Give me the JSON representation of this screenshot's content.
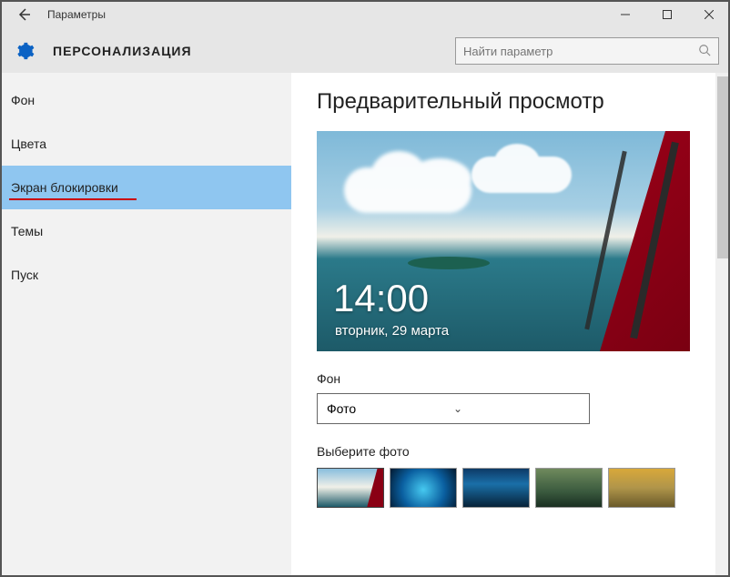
{
  "window": {
    "title": "Параметры"
  },
  "header": {
    "section": "ПЕРСОНАЛИЗАЦИЯ",
    "search_placeholder": "Найти параметр"
  },
  "sidebar": {
    "items": [
      {
        "label": "Фон"
      },
      {
        "label": "Цвета"
      },
      {
        "label": "Экран блокировки"
      },
      {
        "label": "Темы"
      },
      {
        "label": "Пуск"
      }
    ],
    "selected_index": 2
  },
  "content": {
    "preview_title": "Предварительный просмотр",
    "clock_time": "14:00",
    "clock_date": "вторник, 29 марта",
    "background_label": "Фон",
    "background_select_value": "Фото",
    "choose_photo_label": "Выберите фото"
  }
}
